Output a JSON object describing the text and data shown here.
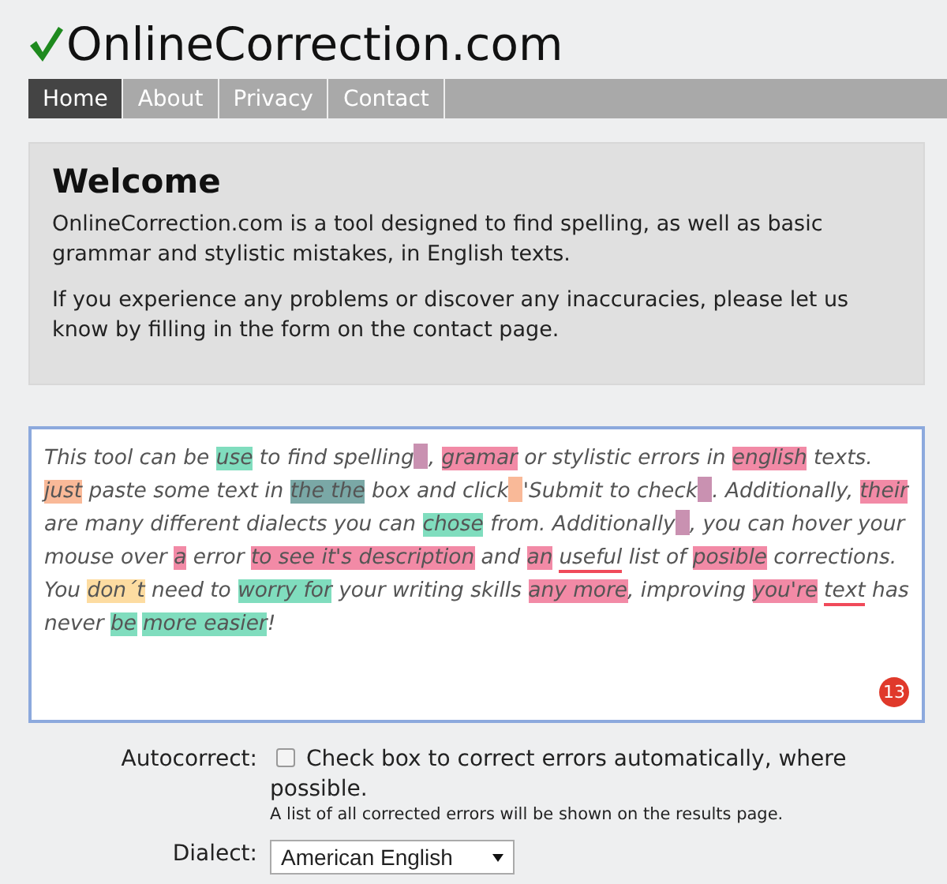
{
  "logo": {
    "text": "OnlineCorrection.com"
  },
  "nav": [
    {
      "label": "Home",
      "selected": true
    },
    {
      "label": "About",
      "selected": false
    },
    {
      "label": "Privacy",
      "selected": false
    },
    {
      "label": "Contact",
      "selected": false
    }
  ],
  "welcome": {
    "title": "Welcome",
    "paragraphs": [
      "OnlineCorrection.com is a tool designed to find spelling, as well as basic grammar and stylistic mistakes, in English texts.",
      "If you experience any problems or discover any inaccuracies, please let us know by filling in the form on the contact page."
    ]
  },
  "editor": {
    "segments": [
      {
        "kind": "plain",
        "text": "This tool can be "
      },
      {
        "kind": "mark",
        "text": "use",
        "color": "#80ddbe"
      },
      {
        "kind": "plain",
        "text": " to find spelling"
      },
      {
        "kind": "gap",
        "color": "#c991b1"
      },
      {
        "kind": "plain",
        "text": ", "
      },
      {
        "kind": "mark",
        "text": "gramar",
        "color": "#f28aa6"
      },
      {
        "kind": "plain",
        "text": " or stylistic errors in "
      },
      {
        "kind": "mark",
        "text": "english",
        "color": "#f28aa6"
      },
      {
        "kind": "plain",
        "text": " texts. "
      },
      {
        "kind": "mark",
        "text": "just",
        "color": "#f9b998"
      },
      {
        "kind": "plain",
        "text": " paste some text in "
      },
      {
        "kind": "mark",
        "text": "the the",
        "color": "#7aa8a6"
      },
      {
        "kind": "plain",
        "text": " box and click"
      },
      {
        "kind": "gap",
        "color": "#f9b998"
      },
      {
        "kind": "plain",
        "text": "'Submit to check"
      },
      {
        "kind": "gap",
        "color": "#c991b1"
      },
      {
        "kind": "plain",
        "text": ". Additionally, "
      },
      {
        "kind": "mark",
        "text": "their",
        "color": "#f28aa6"
      },
      {
        "kind": "plain",
        "text": " are many different dialects you can "
      },
      {
        "kind": "mark",
        "text": "chose",
        "color": "#80ddbe"
      },
      {
        "kind": "plain",
        "text": " from. Additionally"
      },
      {
        "kind": "gap",
        "color": "#c991b1"
      },
      {
        "kind": "plain",
        "text": ", you can hover your mouse over "
      },
      {
        "kind": "mark",
        "text": "a",
        "color": "#f28aa6"
      },
      {
        "kind": "plain",
        "text": " error "
      },
      {
        "kind": "mark",
        "text": "to see it's description",
        "color": "#f28aa6"
      },
      {
        "kind": "plain",
        "text": " and "
      },
      {
        "kind": "mark",
        "text": "an",
        "color": "#f28aa6"
      },
      {
        "kind": "underline",
        "text": "useful",
        "color": "#f04a5a",
        "spaced": true
      },
      {
        "kind": "plain",
        "text": " list of "
      },
      {
        "kind": "mark",
        "text": "posible",
        "color": "#f28aa6"
      },
      {
        "kind": "plain",
        "text": " corrections. You "
      },
      {
        "kind": "mark",
        "text": "don´t",
        "color": "#fddca1"
      },
      {
        "kind": "plain",
        "text": " need to "
      },
      {
        "kind": "mark",
        "text": "worry for",
        "color": "#80ddbe"
      },
      {
        "kind": "plain",
        "text": " your writing skills "
      },
      {
        "kind": "mark",
        "text": "any more",
        "color": "#f28aa6"
      },
      {
        "kind": "plain",
        "text": ", improving "
      },
      {
        "kind": "mark",
        "text": "you're",
        "color": "#f28aa6"
      },
      {
        "kind": "underline",
        "text": "text",
        "color": "#f04a5a",
        "spaced": true
      },
      {
        "kind": "plain",
        "text": " has never "
      },
      {
        "kind": "mark",
        "text": "be",
        "color": "#80ddbe"
      },
      {
        "kind": "mark",
        "text": "more easier",
        "color": "#80ddbe",
        "spaced": true
      },
      {
        "kind": "plain",
        "text": "!"
      }
    ],
    "error_count": "13"
  },
  "autocorrect": {
    "label": "Autocorrect:",
    "checked": false,
    "text": "Check box to correct errors automatically, where possible.",
    "note": "A list of all corrected errors will be shown on the results page."
  },
  "dialect": {
    "label": "Dialect:",
    "value": "American English"
  }
}
